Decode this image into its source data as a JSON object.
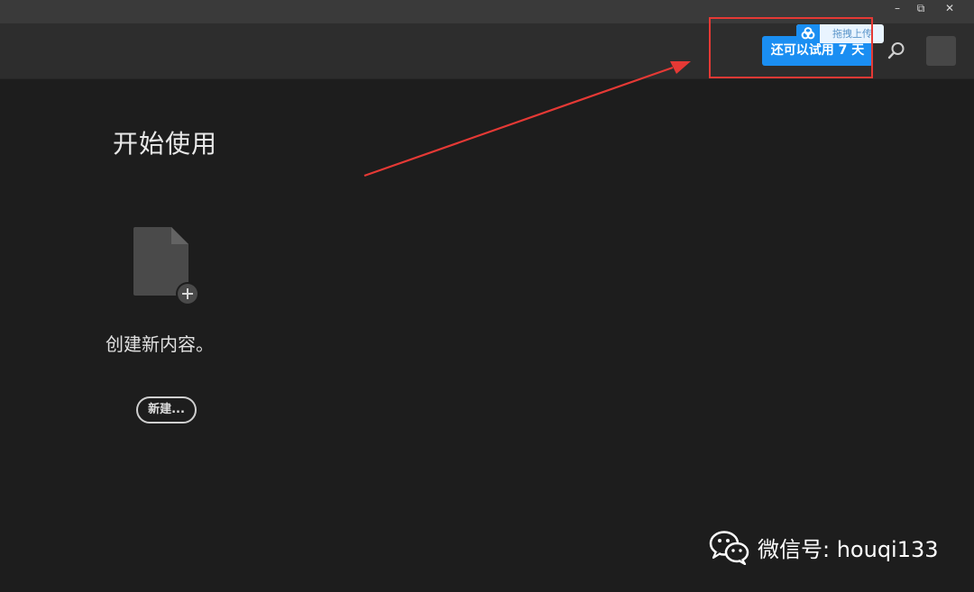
{
  "window_controls": {
    "minimize": "–",
    "restore": "⧉",
    "close": "✕"
  },
  "toolbar": {
    "trial_button_label": "还可以试用 7 天",
    "drag_tip_label": "拖拽上传",
    "search_icon": "search-icon",
    "avatar": "avatar"
  },
  "main": {
    "title": "开始使用",
    "create_prompt": "创建新内容。",
    "new_button_label": "新建..."
  },
  "watermark": {
    "text": "微信号: houqi133",
    "icon": "wechat-icon"
  },
  "colors": {
    "accent": "#1a8ef2",
    "annotation": "#e53935",
    "background": "#1d1d1d",
    "toolbar": "#2d2d2d"
  }
}
